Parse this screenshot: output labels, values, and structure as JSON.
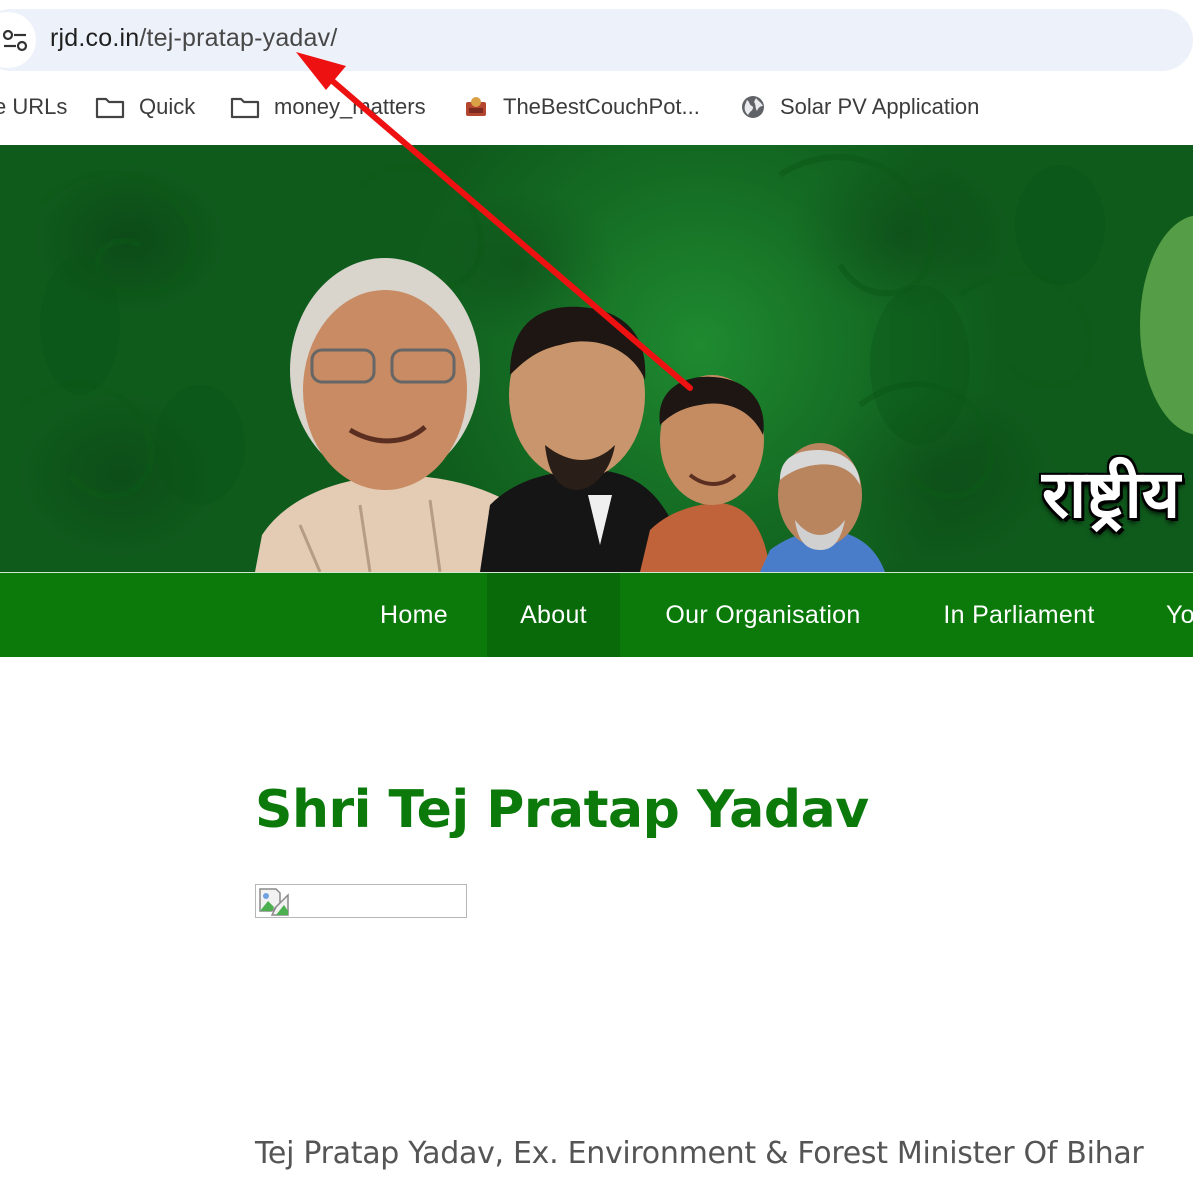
{
  "browser": {
    "url_host": "rjd.co.in",
    "url_path": "/tej-pratap-yadav/",
    "site_info_icon": "tune-icon"
  },
  "bookmarks": [
    {
      "label": "e URLs",
      "icon": "none"
    },
    {
      "label": "Quick",
      "icon": "folder-icon"
    },
    {
      "label": "money_matters",
      "icon": "folder-icon"
    },
    {
      "label": "TheBestCouchPot...",
      "icon": "site-favicon"
    },
    {
      "label": "Solar PV Application",
      "icon": "globe-icon"
    }
  ],
  "banner": {
    "party_name_hindi": "राष्ट्रीय",
    "accent_color": "#146b23"
  },
  "nav": {
    "items": [
      {
        "label": "Home"
      },
      {
        "label": "About"
      },
      {
        "label": "Our Organisation"
      },
      {
        "label": "In Parliament"
      },
      {
        "label": "Yo"
      }
    ],
    "active": "About",
    "color": "#0b7a0b"
  },
  "content": {
    "title": "Shri Tej Pratap Yadav",
    "subtitle": "Tej Pratap Yadav, Ex. Environment & Forest Minister Of Bihar",
    "image_state": "broken-image"
  },
  "annotation": {
    "type": "red-arrow",
    "color": "#ee1111"
  }
}
